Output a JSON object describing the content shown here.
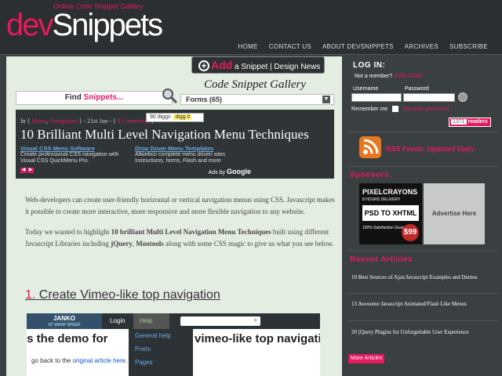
{
  "header": {
    "logo_dev": "dev",
    "logo_snippets": "Snippets",
    "tagline": "Online Code Snippet Gallery",
    "nav": [
      "HOME",
      "CONTACT US",
      "ABOUT DEVSNIPPETS",
      "ARCHIVES",
      "SUBSCRIBE"
    ]
  },
  "main": {
    "add_button": {
      "plus": "+",
      "add": "Add",
      "rest": "a Snippet | Design News"
    },
    "gallery_title": "Code Snippet Gallery",
    "find": {
      "find": "Find ",
      "snippets": "Snippets..."
    },
    "forms_select": "Forms  (65)",
    "forms_arrow": "▼",
    "post": {
      "meta_in": "In { ",
      "cat1": "Menu",
      "sep": ", ",
      "cat2": "Navigation",
      "date": " } - 21st Jan - { ",
      "comments": "8 Comments",
      "close": " }",
      "diggs": "90 diggs",
      "digg_it": "digg it",
      "title": "10 Brilliant Multi Level Navigation Menu Techniques"
    },
    "ads": [
      {
        "title": "Visual CSS Menu Software",
        "text": "Create professional CSS navigation with Visual CSS QuickMenu Pro."
      },
      {
        "title": "Drop Down Menu Templates",
        "text": "Allwebco complete menu driven sites Instructions, forms, Flash and more"
      }
    ],
    "ads_by": "Ads by ",
    "ads_google": "Google",
    "paragraph1": "Web-developers can create user-friendly horizontal or vertical navigation menus using CSS. Javascript makes it possible to create more interactive, more responsive and more flexible navigation to any website.",
    "p2": {
      "a": "Today we wanted to highlight ",
      "b": "10 brilliant Multi Level Navigation Menu Techniques",
      "c": " built using different Javascript Libraries including ",
      "d": "jQuery",
      "e": ", ",
      "f": "Mootools",
      "g": " along with some CSS magic to give us what you see below."
    },
    "section": {
      "num": "1.",
      "title": " Create Vimeo-like top navigation"
    },
    "demo": {
      "janko": "JANKO",
      "janko_sub": "AT WARP SPEED",
      "login": "Login",
      "help": "Help",
      "search_icon": "⌕",
      "text_left": "is the demo for",
      "text_right": "vimeo-like top navigati",
      "menu": [
        "General help",
        "Posts",
        "Pages"
      ],
      "goback_pre": "go back to the ",
      "goback_link": "original article here",
      "goback_post": "."
    }
  },
  "sidebar": {
    "login_title": "LOG IN:",
    "not_member": "Not a member? ",
    "join": "JOIN NOW!",
    "username_label": "Username",
    "password_label": "Password",
    "remember": "Remember me",
    "recover": "Recover password",
    "readers_count": "1371",
    "readers_label": " readers",
    "rss": "RSS Feeds: Updated Daily",
    "sponsors": "Sponsors",
    "pixelcrayons": {
      "name": "PIXELCRAYONS",
      "hours": "8 HOURS DELIVERY",
      "psd": "PSD TO XHTML",
      "sat": "100% Satisfaction Guaranteed",
      "price": "$99"
    },
    "advertise": "Advertise Here",
    "recent_title": "Recent Articles",
    "articles": [
      "10 Best Sources of Ajax/Javascript Examples and Demos",
      "13 Awesome Javascript Animated/Flash Like Menus",
      "20 jQuery Plugins for Unforgettable User Experience"
    ],
    "more": "More Articles"
  },
  "colors": {
    "accent": "#e5195f",
    "dark": "#2f3436",
    "bg": "#3a3f41",
    "content": "#e4ede2"
  },
  "icons": [
    "magnifier-icon",
    "rss-icon",
    "dropdown-arrow-icon",
    "prev-arrow-icon",
    "next-arrow-icon",
    "search-icon"
  ]
}
